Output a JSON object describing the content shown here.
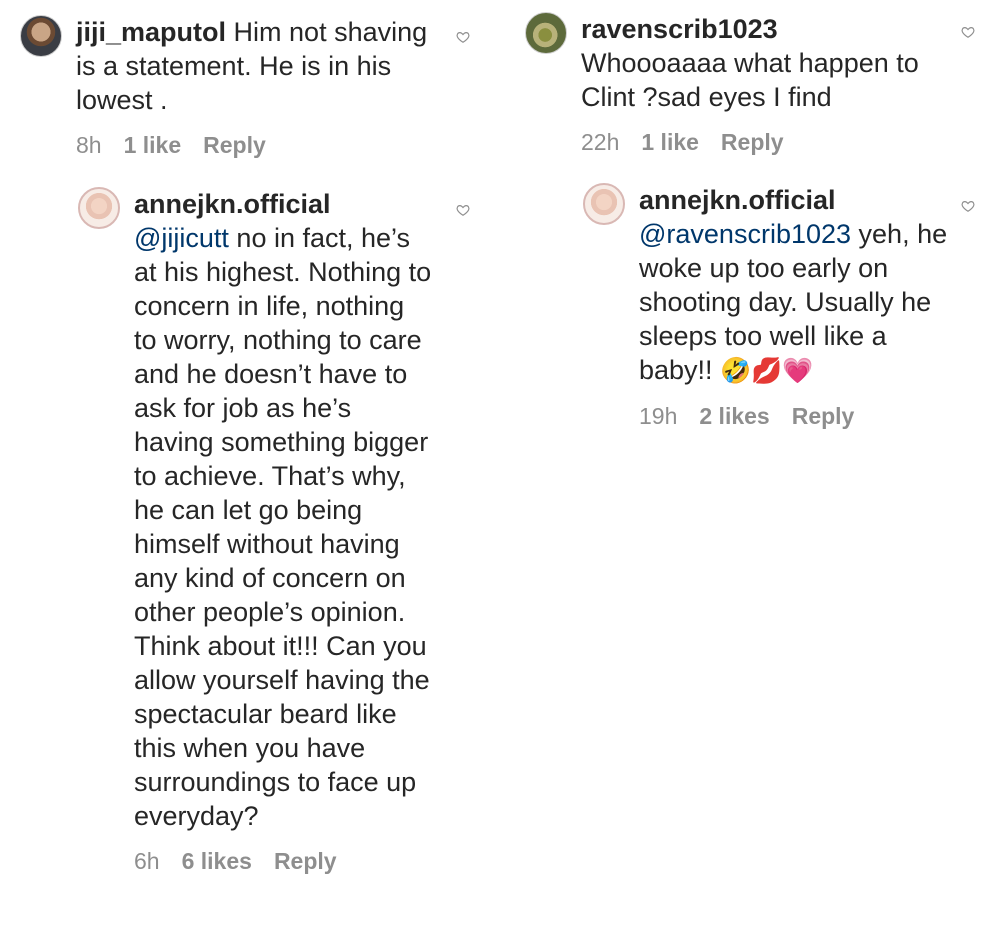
{
  "comments": [
    {
      "username": "jiji_maputol",
      "text": "Him not shaving is a statement. He is in his lowest .",
      "time": "8h",
      "likes": "1 like",
      "reply": "Reply",
      "replies": [
        {
          "username": "annejkn.official",
          "mention": "@jijicutt",
          "text": " no in fact, he’s at his highest. Nothing to concern in life, nothing to worry, nothing to care and he doesn’t have to ask for job as he’s having something bigger to achieve. That’s why, he can let go being himself without having any kind of concern on other people’s opinion. Think about it!!! Can you allow yourself having the spectacular beard like this when you have surroundings to face up everyday?",
          "time": "6h",
          "likes": "6 likes",
          "reply": "Reply"
        }
      ]
    },
    {
      "username": "ravenscrib1023",
      "text": "Whoooaaaa what happen to Clint ?sad eyes I find",
      "time": "22h",
      "likes": "1 like",
      "reply": "Reply",
      "replies": [
        {
          "username": "annejkn.official",
          "mention": "@ravenscrib1023",
          "text": " yeh, he woke up too early on shooting day. Usually he sleeps too well like a baby!! ",
          "emojis": "🤣💋💗",
          "time": "19h",
          "likes": "2 likes",
          "reply": "Reply"
        }
      ]
    }
  ],
  "colors": {
    "text": "#262626",
    "meta": "#8e8e8e",
    "mention": "#00376b"
  },
  "icons": {
    "like": "heart-outline-icon"
  }
}
